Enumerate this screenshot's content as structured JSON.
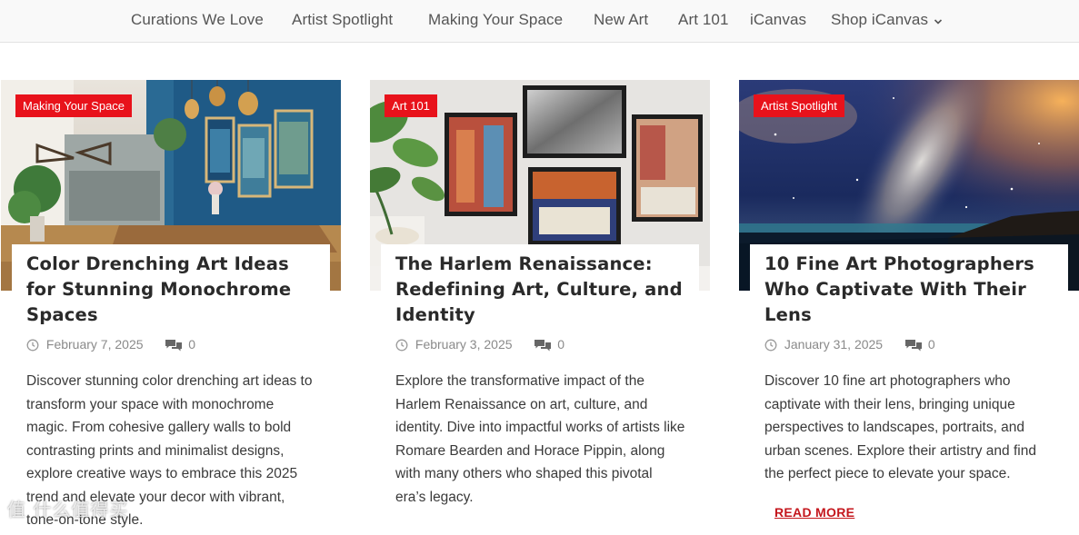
{
  "nav": {
    "items": [
      {
        "label": "Curations We Love"
      },
      {
        "label": "Artist Spotlight"
      },
      {
        "label": "Making Your Space"
      },
      {
        "label": "New Art"
      },
      {
        "label": "Art 101"
      },
      {
        "label": "iCanvas"
      },
      {
        "label": "Shop iCanvas"
      }
    ],
    "dropdown_icon": "chevron-down-icon"
  },
  "posts": [
    {
      "category": "Making Your Space",
      "title": "Color Drenching Art Ideas for Stunning Monochrome Spaces",
      "date": "February 7, 2025",
      "comments": "0",
      "excerpt": "Discover stunning color drenching art ideas to transform your space with monochrome magic. From cohesive gallery walls to bold contrasting prints and minimalist designs, explore creative ways to embrace this 2025 trend and elevate your decor with vibrant, tone-on-tone style."
    },
    {
      "category": "Art 101",
      "title": "The Harlem Renaissance: Redefining Art, Culture, and Identity",
      "date": "February 3, 2025",
      "comments": "0",
      "excerpt": "Explore the transformative impact of the Harlem Renaissance on art, culture, and identity. Dive into impactful works of artists like Romare Bearden and Horace Pippin, along with many others who shaped this pivotal era’s legacy."
    },
    {
      "category": "Artist Spotlight",
      "title": "10 Fine Art Photographers Who Captivate With Their Lens",
      "date": "January 31, 2025",
      "comments": "0",
      "excerpt": "Discover 10 fine art photographers who captivate with their lens, bringing unique perspectives to landscapes, portraits, and urban scenes. Explore their artistry and find the perfect piece to elevate your space.",
      "read_more": "READ MORE"
    }
  ],
  "colors": {
    "badge": "#e8121b",
    "read_more": "#c4161c",
    "nav_bg": "#f9f9f9"
  },
  "watermark": "值 什么值得买"
}
